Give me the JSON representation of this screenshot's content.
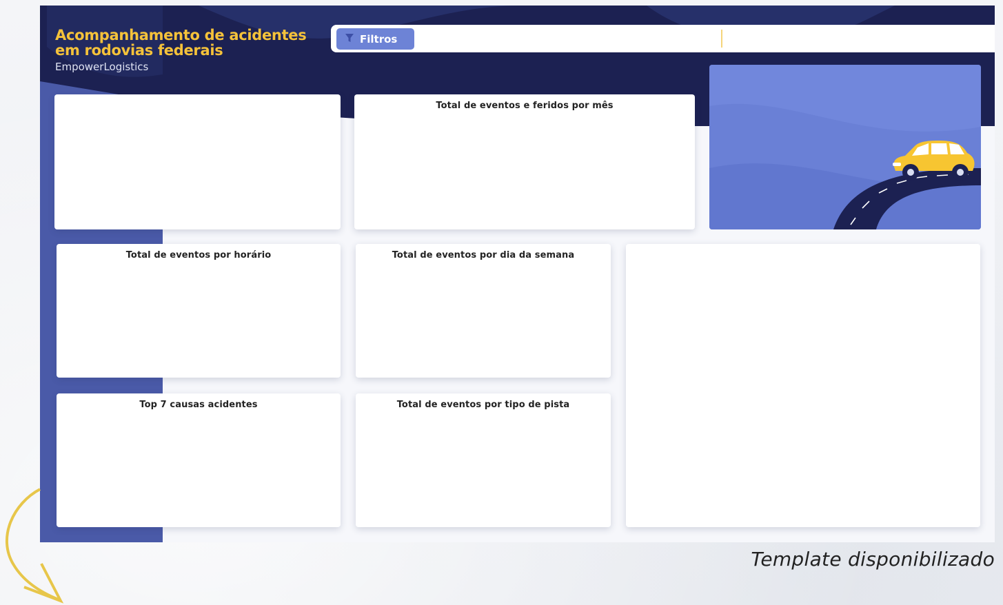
{
  "header": {
    "title_line1": "Acompanhamento de acidentes",
    "title_line2": "em rodovias federais",
    "subtitle": "EmpowerLogistics"
  },
  "filters": {
    "button_label": "Filtros",
    "icon": "funnel-icon"
  },
  "cards": {
    "monthly": "Total de eventos e feridos por mês",
    "hourly": "Total de eventos por horário",
    "weekday": "Total de eventos por dia da semana",
    "causes": "Top 7 causas acidentes",
    "track_type": "Total de eventos por tipo de pista"
  },
  "caption": "Template disponibilizado",
  "colors": {
    "navy": "#1c2152",
    "accent_blue": "#6d83d6",
    "title_yellow": "#f5c23a",
    "sidebar_blue": "#4a5aa8"
  },
  "hero_icons": [
    "car-icon",
    "road-icon"
  ]
}
